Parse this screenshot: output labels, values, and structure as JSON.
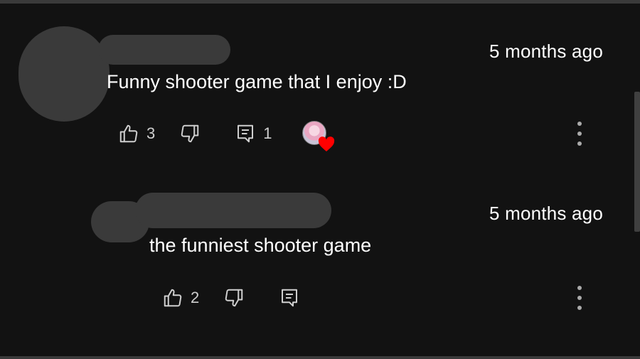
{
  "comments": [
    {
      "timestamp": "5 months ago",
      "text": "Funny shooter game that I enjoy :D",
      "likes": "3",
      "replies": "1",
      "creator_heart": true
    },
    {
      "timestamp": "5 months ago",
      "text": "the funniest shooter game",
      "likes": "2",
      "replies": "",
      "creator_heart": false
    }
  ],
  "colors": {
    "background": "#121212",
    "text": "#ffffff",
    "icon": "#cfcfcf",
    "redaction": "#3a3a3a",
    "heart": "#ff0000"
  },
  "icons": {
    "like": "thumbs-up-icon",
    "dislike": "thumbs-down-icon",
    "reply": "comment-reply-icon",
    "more": "more-vertical-icon",
    "heart": "creator-heart-icon"
  }
}
